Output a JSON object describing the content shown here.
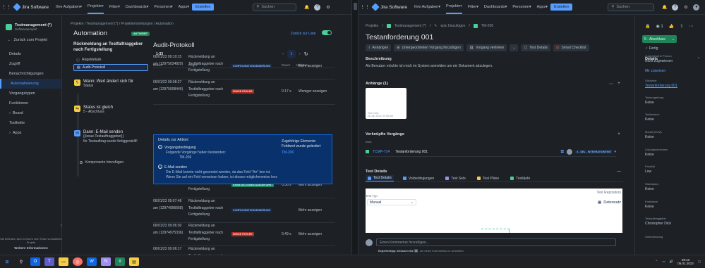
{
  "left_window": {
    "app": {
      "name": "Jira Software"
    },
    "nav": {
      "items": [
        "Ihre Aufgaben",
        "Projekte",
        "Filter",
        "Dashboards",
        "Personen",
        "Apps"
      ],
      "active": "Projekte",
      "create_label": "Erstellen"
    },
    "search": {
      "placeholder": "Suchen"
    },
    "sidebar": {
      "project_name": "Testmanagement (*)",
      "project_type": "Softwareprojekt",
      "back_label": "Zurück zum Projekt",
      "items": [
        "Details",
        "Zugriff",
        "Benachrichtigungen",
        "Automatisierung",
        "Vorgangstypen",
        "Funktionen",
        "Board",
        "Toolkette",
        "Apps"
      ],
      "active_item": "Automatisierung",
      "footer_text": "Sie befinden sich in einem vom Team verwalteten Projekt",
      "footer_link": "Weitere Informationen"
    },
    "breadcrumb": [
      "Projekte",
      "Testmanagement (*)",
      "Projekteinstellungen",
      "Automation"
    ],
    "page": {
      "title": "Automation",
      "status_badge": "AKTIVIERT",
      "back_list": "Zurück zur Liste"
    },
    "rule": {
      "name": "Rückmeldung an Testfalltraggeber nach Fertigstellung",
      "tabs": [
        "Regeldetails",
        "Audit-Protokoll"
      ],
      "active_tab": "Audit-Protokoll",
      "trigger_title": "Wann: Wert ändert sich für",
      "trigger_sub": "Status",
      "condition_title": "Status ist gleich",
      "condition_sub": "5 - Abschluss",
      "action_title": "Dann: E-Mail senden",
      "action_lines": [
        "{{issue.Testauftraggeber}}",
        "Ihr Testauftrag wurde fertiggestellt!"
      ],
      "add_component": "Komponente hinzufügen"
    },
    "audit": {
      "title": "Audit-Protokoll",
      "count": "1-33",
      "current_page": "1",
      "columns": [
        "Datum",
        "Regel",
        "Status",
        "Dauer",
        "Aktionen"
      ],
      "rows": [
        {
          "date": "06/01/23 09:10:15",
          "id": "am (12975034820)",
          "rule": [
            "Rückmeldung an",
            "Testfalltraggeber nach",
            "Fertigstellung"
          ],
          "status": "KONFIGURATIONSÄNDERUNG",
          "status_kind": "blue",
          "duration": "",
          "action": "Mehr anzeigen"
        },
        {
          "date": "06/01/23 09:08:27",
          "id": "am (12975008446)",
          "rule": [
            "Rückmeldung an",
            "Testfalltraggeber nach",
            "Fertigstellung"
          ],
          "status": "EINIGE FEHLER",
          "status_kind": "red",
          "duration": "0.17 s",
          "action": "Weniger anzeigen"
        },
        {
          "date": "06/01/23 09:08:08",
          "id": "am (12975001862)",
          "rule": [
            "Rückmeldung an",
            "Testfalltraggeber nach",
            "Fertigstellung"
          ],
          "status": "KEINE AKTIONEN AUSGEFÜHRT",
          "status_kind": "green",
          "duration": "0.36 s",
          "action": "Mehr anzeigen"
        },
        {
          "date": "06/01/23 09:07:48",
          "id": "am (12974996668)",
          "rule": [
            "Rückmeldung an",
            "Testfalltraggeber nach",
            "Fertigstellung"
          ],
          "status": "KONFIGURATIONSÄNDERUNG",
          "status_kind": "blue",
          "duration": "",
          "action": "Mehr anzeigen"
        },
        {
          "date": "06/01/23 09:06:30",
          "id": "am (12974975336)",
          "rule": [
            "Rückmeldung an",
            "Testfalltraggeber nach",
            "Fertigstellung"
          ],
          "status": "EINIGE FEHLER",
          "status_kind": "red",
          "duration": "0.49 s",
          "action": "Mehr anzeigen"
        },
        {
          "date": "06/01/23 09:06:17",
          "id": "",
          "rule": [
            "Rückmeldung an",
            "Testfalltraggeber nach"
          ],
          "status": "",
          "status_kind": "",
          "duration": "",
          "action": ""
        }
      ],
      "detail": {
        "heading": "Details zur Aktion:",
        "item1_title": "Vorgangsbedingung",
        "item1_sub": "Folgende Vorgänge haben bestanden:",
        "item1_issue": "TM-206",
        "item2_title": "E-Mail senden",
        "item2_line1": "Die E-Mail konnte nicht gesendet werden, da das Feld \"An\" leer ist.",
        "item2_line2": "Wenn Sie auf ein Feld verweisen haben, ist dieses möglicherweise leer.",
        "related_heading": "Zugehörige Elemente:",
        "related_sub": "Feldwert wurde geändert",
        "related_link": "TM-206"
      }
    }
  },
  "right_window": {
    "app": {
      "name": "Jira Software"
    },
    "nav": {
      "items": [
        "Ihre Aufgaben",
        "Projekte",
        "Filter",
        "Dashboards",
        "Personen",
        "Apps"
      ],
      "active": "Projekte",
      "create_label": "Erstellen"
    },
    "search": {
      "placeholder": "Suchen"
    },
    "breadcrumb": [
      "Projekte",
      "Testmanagement (*)",
      "epic hinzufügen",
      "TM-206"
    ],
    "issue_title": "Testanforderung 001",
    "toolbar": [
      "Anhängen",
      "Untergeordneten Vorgang hinzufügen",
      "Vorgang verlinken",
      "Test Details",
      "Smart Checklist"
    ],
    "description_label": "Beschreibung",
    "description_text": "Als Benutzer möchte ich mich im System anmelden um ein Dokument abzulegen.",
    "attachments_label": "Anhänge (1)",
    "attachment_caption": [
      "Test Case",
      "06 Jan 2023, 09:08 AM"
    ],
    "linked_label": "Verknüpfte Vorgänge",
    "linked_sub": "tests",
    "linked_issue": {
      "key": "TCMP-714",
      "title": "Testanforderung 001",
      "status": "4 - DEL - INTEGRATIONTEST"
    },
    "test_details_label": "Test Details",
    "test_tabs": [
      "Test Details",
      "Vorbedingungen",
      "Test Sets",
      "Test Pläne",
      "Testläufe"
    ],
    "test_tab_colors": [
      "#579dff",
      "#579dff",
      "#9f8fef",
      "#f5cd47",
      "#4bce97"
    ],
    "test_type_label": "Test Typ",
    "test_type_value": "Manual",
    "test_repo": "Test Repository",
    "dataset": "Datensatz",
    "comment_placeholder": "Einen Kommentar hinzufügen...",
    "pro_tip": "Expertentipp: Drücken Sie",
    "pro_tip_key": "M",
    "pro_tip_end": ", um einen Kommentar zu schreiben.",
    "side": {
      "watch_count": "1",
      "status": "5 - Abschluss",
      "resolution": "Fertig",
      "details_label": "Details",
      "fields": [
        {
          "label": "Zugewiesene Person",
          "value": "Nicht zugewiesen",
          "style": "plain"
        },
        {
          "label": "",
          "value": "Mir zuweisen",
          "style": "link"
        },
        {
          "label": "Stichwort",
          "value": "Testanforderung 001",
          "style": "underline"
        },
        {
          "label": "Testumgebung",
          "value": "Keine",
          "style": "plain"
        },
        {
          "label": "Testbereich",
          "value": "Keine",
          "style": "plain"
        },
        {
          "label": "Modul (ECM)",
          "value": "Keine",
          "style": "plain"
        },
        {
          "label": "Lösungsversionen",
          "value": "Keine",
          "style": "plain"
        },
        {
          "label": "Priorität",
          "value": "Low",
          "style": "plain"
        },
        {
          "label": "Startdatum",
          "value": "Keine",
          "style": "plain"
        },
        {
          "label": "Enddatum",
          "value": "Keine",
          "style": "plain"
        },
        {
          "label": "Testauftraggeber",
          "value": "Christopher Dick",
          "style": "plain"
        },
        {
          "label": "Umbedeutung",
          "value": "",
          "style": "plain"
        }
      ]
    }
  },
  "taskbar": {
    "time": "09:10",
    "date": "06.01.2023"
  }
}
